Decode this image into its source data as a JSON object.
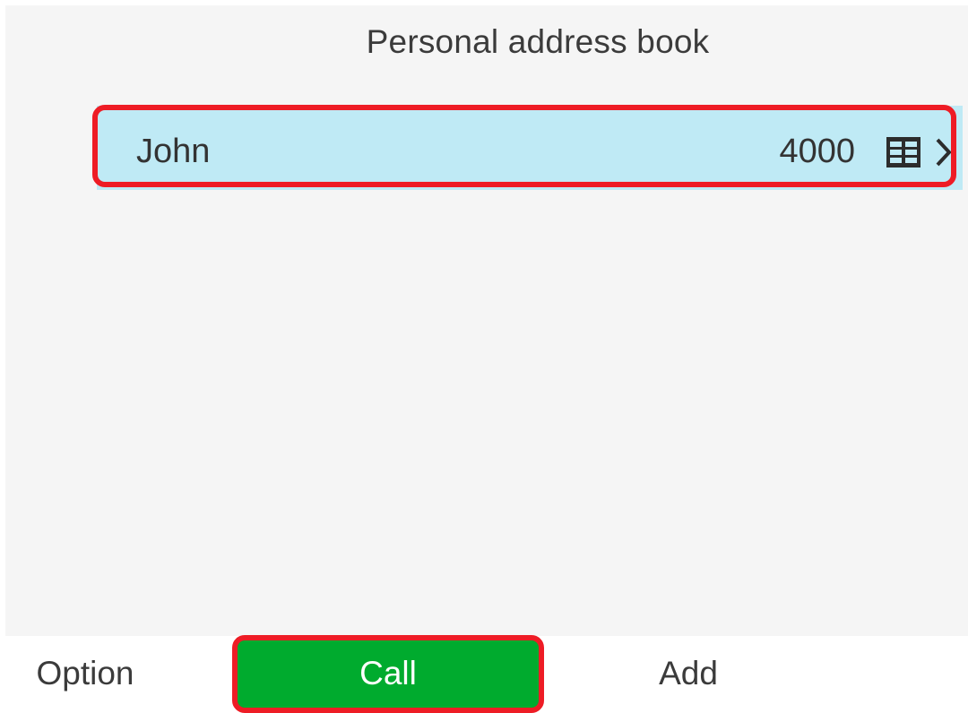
{
  "header": {
    "title": "Personal address book"
  },
  "contacts": [
    {
      "name": "John",
      "number": "4000",
      "icon": "directory-icon",
      "action_icon": "chevron-right-icon",
      "selected": true
    }
  ],
  "softkeys": {
    "option": "Option",
    "call": "Call",
    "add": "Add"
  },
  "colors": {
    "selected_row": "#bfeaf5",
    "call_button": "#00ab2e",
    "highlight": "#ee1c25",
    "background": "#f5f5f5"
  }
}
